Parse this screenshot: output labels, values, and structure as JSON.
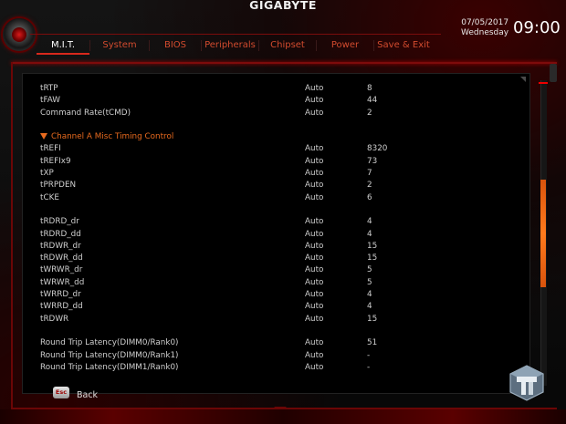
{
  "brand": "GIGABYTE",
  "datetime": {
    "date": "07/05/2017",
    "weekday": "Wednesday",
    "time": "09:00"
  },
  "tabs": [
    {
      "label": "M.I.T.",
      "active": true
    },
    {
      "label": "System",
      "active": false
    },
    {
      "label": "BIOS",
      "active": false
    },
    {
      "label": "Peripherals",
      "active": false
    },
    {
      "label": "Chipset",
      "active": false
    },
    {
      "label": "Power",
      "active": false
    },
    {
      "label": "Save & Exit",
      "active": false
    }
  ],
  "rows_top": [
    {
      "name": "tRTP",
      "mode": "Auto",
      "value": "8"
    },
    {
      "name": "tFAW",
      "mode": "Auto",
      "value": "44"
    },
    {
      "name": "Command Rate(tCMD)",
      "mode": "Auto",
      "value": "2"
    }
  ],
  "section": {
    "title": "Channel A Misc Timing Control"
  },
  "rows_misc": [
    {
      "name": "tREFI",
      "mode": "Auto",
      "value": "8320"
    },
    {
      "name": "tREFIx9",
      "mode": "Auto",
      "value": "73"
    },
    {
      "name": "tXP",
      "mode": "Auto",
      "value": "7"
    },
    {
      "name": "tPRPDEN",
      "mode": "Auto",
      "value": "2"
    },
    {
      "name": "tCKE",
      "mode": "Auto",
      "value": "6"
    }
  ],
  "rows_turnaround": [
    {
      "name": "tRDRD_dr",
      "mode": "Auto",
      "value": "4"
    },
    {
      "name": "tRDRD_dd",
      "mode": "Auto",
      "value": "4"
    },
    {
      "name": "tRDWR_dr",
      "mode": "Auto",
      "value": "15"
    },
    {
      "name": "tRDWR_dd",
      "mode": "Auto",
      "value": "15"
    },
    {
      "name": "tWRWR_dr",
      "mode": "Auto",
      "value": "5"
    },
    {
      "name": "tWRWR_dd",
      "mode": "Auto",
      "value": "5"
    },
    {
      "name": "tWRRD_dr",
      "mode": "Auto",
      "value": "4"
    },
    {
      "name": "tWRRD_dd",
      "mode": "Auto",
      "value": "4"
    },
    {
      "name": "tRDWR",
      "mode": "Auto",
      "value": "15"
    }
  ],
  "rows_latency": [
    {
      "name": "Round Trip Latency(DIMM0/Rank0)",
      "mode": "Auto",
      "value": "51"
    },
    {
      "name": "Round Trip Latency(DIMM0/Rank1)",
      "mode": "Auto",
      "value": "-"
    },
    {
      "name": "Round Trip Latency(DIMM1/Rank0)",
      "mode": "Auto",
      "value": "-"
    }
  ],
  "footer": {
    "esc_key": "Esc",
    "back_label": "Back"
  },
  "colors": {
    "accent": "#d8281c",
    "section": "#e86a1e",
    "scroll_thumb": "#ff7a1c"
  },
  "icons": {
    "logo": "gigabyte-disc-icon",
    "watermark": "tweaktown-logo-icon",
    "section_arrow": "triangle-down-icon"
  }
}
